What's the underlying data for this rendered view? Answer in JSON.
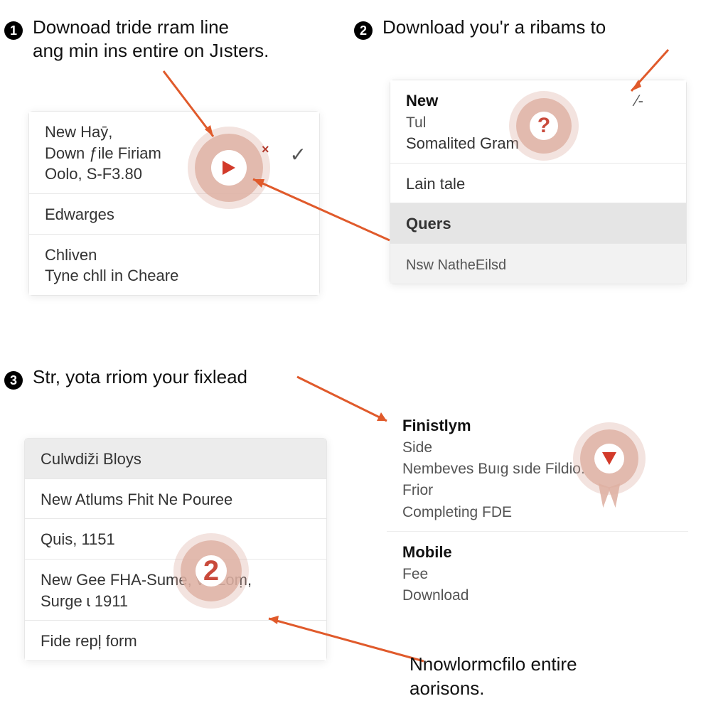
{
  "step1": {
    "badge": "1",
    "heading_line1": "Downoad tride rram line",
    "heading_line2": "ang min ins entire on Jısters."
  },
  "step2": {
    "badge": "2",
    "heading": "Download you'r a ribams to"
  },
  "step3": {
    "badge": "3",
    "heading": "Str, yota rriom your fixlead"
  },
  "card1": {
    "r1_line1": "New Haȳ,",
    "r1_line2": "Down ƒile Firiam",
    "r1_line3": "Oolo, S-F3.80",
    "r2": "Edwarges",
    "r3_line1": "Chliven",
    "r3_line2": "Tyne chll in Cheare"
  },
  "card2": {
    "r1_bold": "New",
    "r1_sub": "Tul",
    "r1_line3": "Somalited Gram",
    "r2": "Lain tale",
    "r3": "Quers",
    "r4": "Nsw NatheEilsd"
  },
  "card3": {
    "r1": "Culwdiži Bloys",
    "r2": "New Atlums Fhit Ne Pouree",
    "r3": "Quis, 1151",
    "r4_line1": "New Gee FHA-Sume, vs Zoṃ,",
    "r4_line2": "Surge ɩ 1911",
    "r5": "Fide repļ form"
  },
  "card4": {
    "r1_bold": "Finistlym",
    "r1_sub1": "Side",
    "r1_sub2": "Nembeves Buıg sıde Fildio.",
    "r1_sub3": "Frior",
    "r1_sub4": "Completing FDE",
    "r2_bold": "Mobile",
    "r2_sub1": "Fee",
    "r2_sub2": "Download"
  },
  "annotations": {
    "badge2_num": "2",
    "qmark": "?",
    "chevron": "✓",
    "slash_mark": "⁄-",
    "x_mark": "×"
  },
  "note": {
    "line1": "Nnowlormcfilo entire",
    "line2": "aorisons."
  }
}
